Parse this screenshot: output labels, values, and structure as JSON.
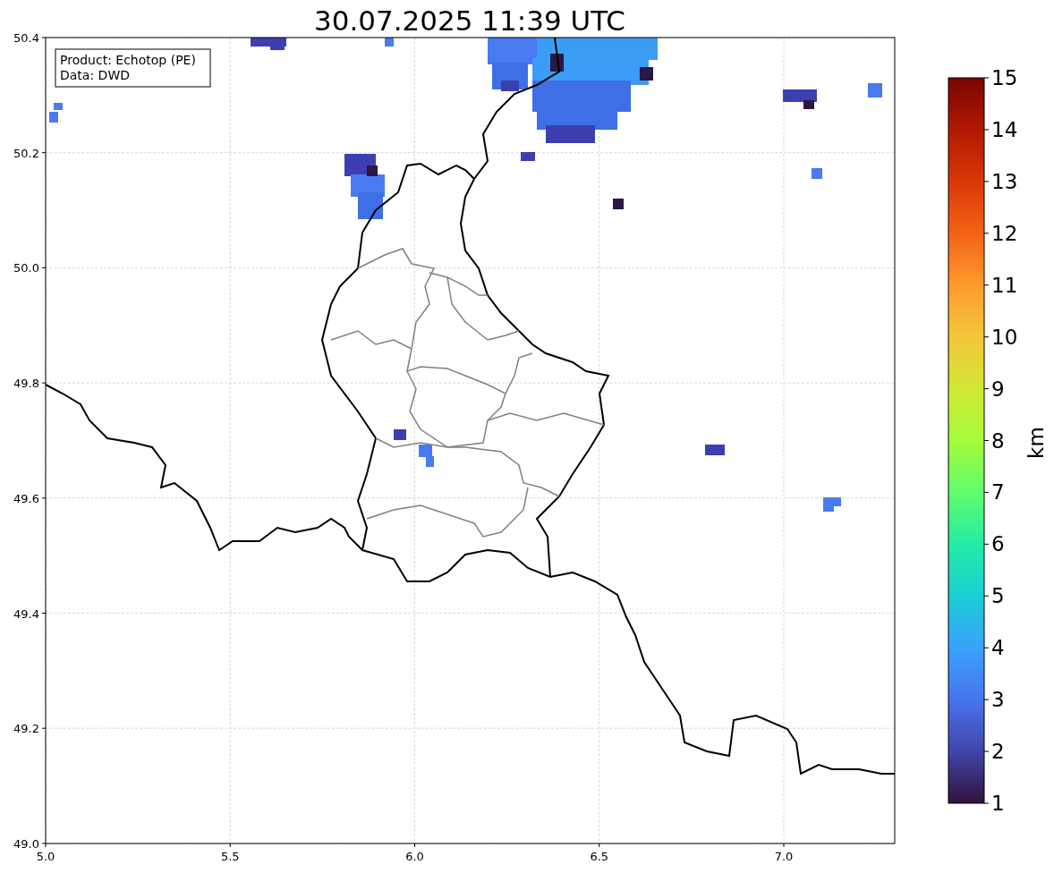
{
  "title": "30.07.2025 11:39 UTC",
  "info_box": {
    "lines": [
      "Product: Echotop (PE)",
      "Data: DWD"
    ]
  },
  "x_axis": {
    "ticks": [
      "5.0",
      "5.5",
      "6.0",
      "6.5",
      "7.0"
    ]
  },
  "y_axis": {
    "ticks": [
      "50.4",
      "50.2",
      "50.0",
      "49.8",
      "49.6",
      "49.4",
      "49.2",
      "49.0"
    ]
  },
  "colorbar": {
    "label": "km",
    "ticks": [
      "15",
      "14",
      "13",
      "12",
      "11",
      "10",
      "9",
      "8",
      "7",
      "6",
      "5",
      "4",
      "3",
      "2",
      "1"
    ]
  }
}
